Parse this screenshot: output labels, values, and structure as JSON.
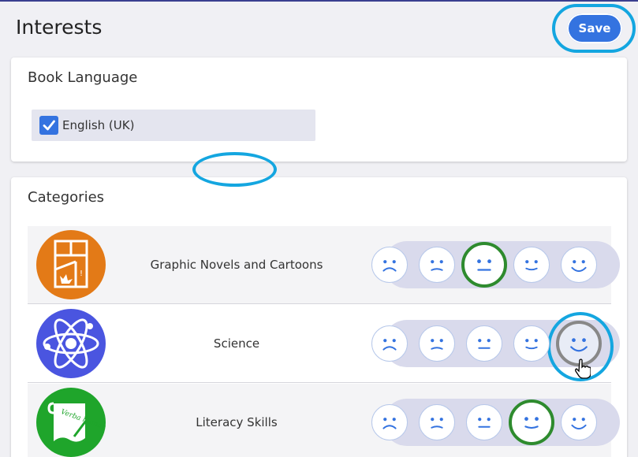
{
  "header": {
    "title": "Interests",
    "save_label": "Save"
  },
  "book_language": {
    "title": "Book Language",
    "options": [
      {
        "label": "English (UK)",
        "checked": true
      }
    ]
  },
  "categories": {
    "title": "Categories",
    "items": [
      {
        "name": "Graphic Novels and Cartoons",
        "icon": "comic-book-icon",
        "icon_color": "#e37a17",
        "rating": 3,
        "rating_max": 5
      },
      {
        "name": "Science",
        "icon": "atom-icon",
        "icon_color": "#4a55e0",
        "rating": 0,
        "rating_max": 5,
        "hovered": 5
      },
      {
        "name": "Literacy Skills",
        "icon": "scroll-quill-icon",
        "icon_color": "#1fa52b",
        "rating": 4,
        "rating_max": 5,
        "icon_text": "Verba humanum"
      }
    ]
  },
  "colors": {
    "accent": "#3473e0",
    "highlight": "#14a6e0",
    "selected": "#2e8b2e"
  }
}
